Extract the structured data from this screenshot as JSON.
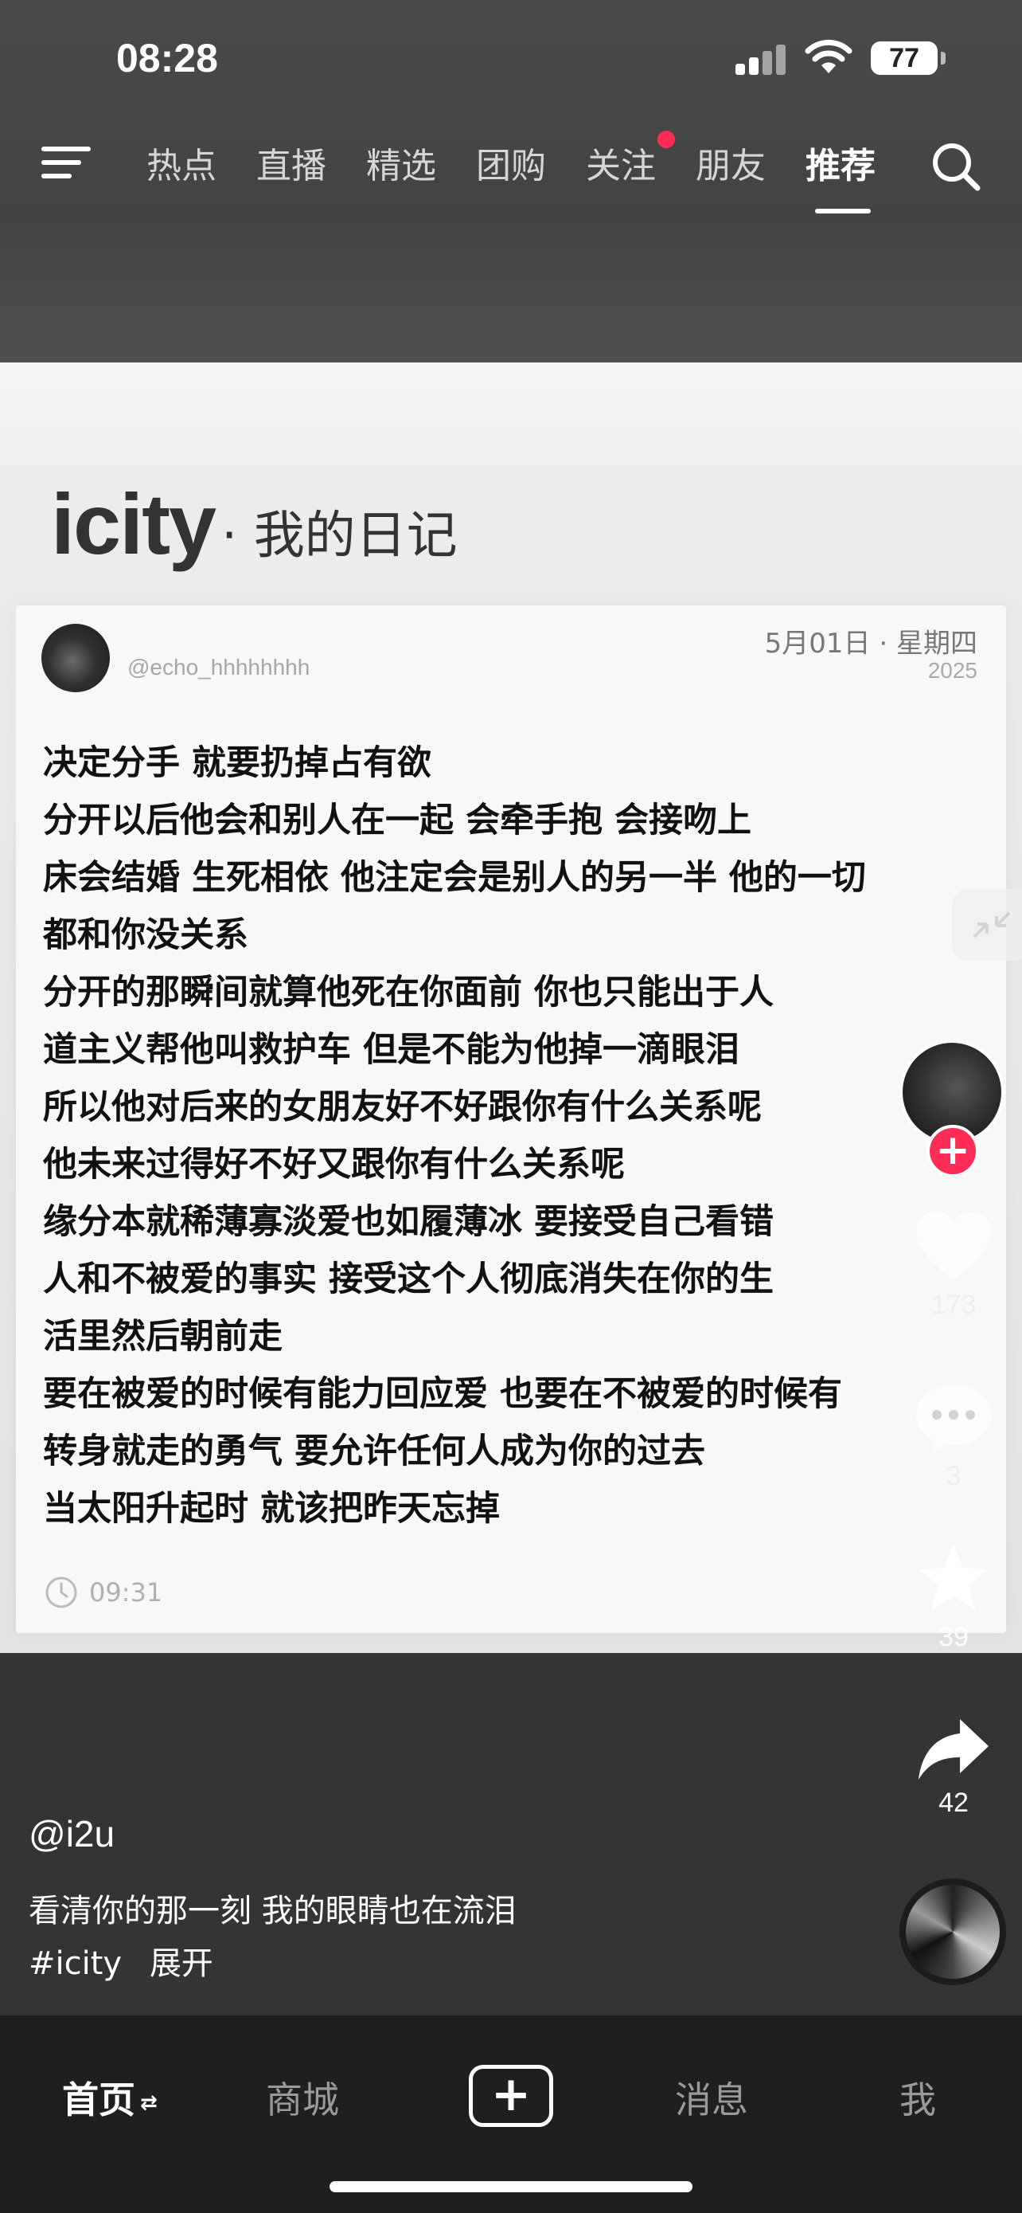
{
  "status_bar": {
    "time": "08:28",
    "battery": "77"
  },
  "nav": {
    "tabs": [
      {
        "label": "热点"
      },
      {
        "label": "直播"
      },
      {
        "label": "精选"
      },
      {
        "label": "团购"
      },
      {
        "label": "关注"
      },
      {
        "label": "朋友"
      },
      {
        "label": "推荐"
      }
    ],
    "active_tab": "推荐",
    "badge_tab": "关注"
  },
  "post_image": {
    "app_name": "icity",
    "subtitle": "· 我的日记",
    "handle": "@echo_hhhhhhhh",
    "date": "5月01日 · 星期四",
    "year": "2025",
    "lines": [
      "决定分手 就要扔掉占有欲",
      "分开以后他会和别人在一起 会牵手抱 会接吻上",
      "床会结婚 生死相依 他注定会是别人的另一半 他的一切",
      "都和你没关系",
      "分开的那瞬间就算他死在你面前 你也只能出于人",
      "道主义帮他叫救护车 但是不能为他掉一滴眼泪",
      "所以他对后来的女朋友好不好跟你有什么关系呢",
      "他未来过得好不好又跟你有什么关系呢",
      "缘分本就稀薄寡淡爱也如履薄冰 要接受自己看错",
      "人和不被爱的事实 接受这个人彻底消失在你的生",
      "活里然后朝前走",
      "要在被爱的时候有能力回应爱 也要在不被爱的时候有",
      "转身就走的勇气 要允许任何人成为你的过去",
      "当太阳升起时 就该把昨天忘掉"
    ],
    "time": "09:31"
  },
  "actions": {
    "likes": "173",
    "comments": "3",
    "favorites": "39",
    "shares": "42"
  },
  "post": {
    "author": "@i2u",
    "caption": "看清你的那一刻 我的眼睛也在流泪",
    "hashtag": "#icity",
    "expand": "展开"
  },
  "tabbar": {
    "home": "首页",
    "mall": "商城",
    "create": "+",
    "messages": "消息",
    "me": "我"
  },
  "colors": {
    "accent": "#ff2d55",
    "background": "#343434"
  }
}
